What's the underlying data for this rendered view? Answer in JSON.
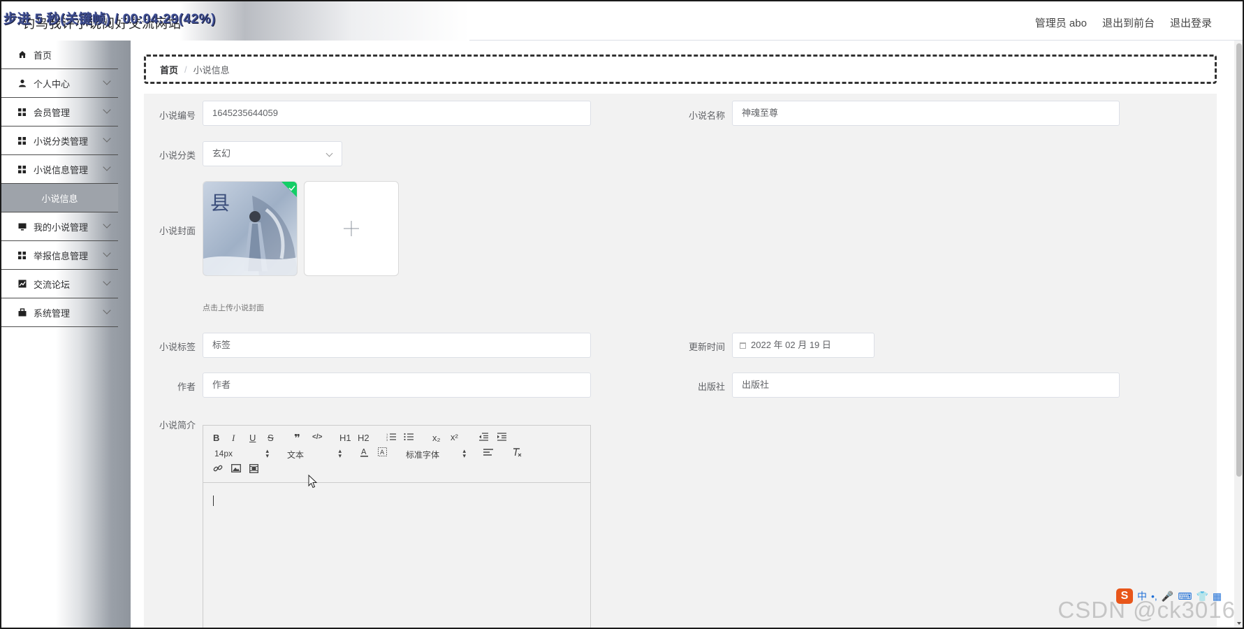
{
  "header": {
    "site_title": "钓鸟我评小说阅好交流网站",
    "overlay_caption": "步进 5 秒(关键帧) / 00:04:29(42%)",
    "links": [
      "管理员 abo",
      "退出到前台",
      "退出登录"
    ]
  },
  "sidebar": {
    "items": [
      {
        "label": "首页",
        "icon": "home-icon"
      },
      {
        "label": "个人中心",
        "icon": "user-icon"
      },
      {
        "label": "会员管理",
        "icon": "grid-icon"
      },
      {
        "label": "小说分类管理",
        "icon": "grid-icon"
      },
      {
        "label": "小说信息管理",
        "icon": "grid-icon"
      },
      {
        "label": "我的小说管理",
        "icon": "monitor-icon"
      },
      {
        "label": "举报信息管理",
        "icon": "grid-icon"
      },
      {
        "label": "交流论坛",
        "icon": "chart-icon"
      },
      {
        "label": "系统管理",
        "icon": "briefcase-icon"
      }
    ],
    "active_sub": "小说信息"
  },
  "breadcrumb": {
    "home": "首页",
    "separator": "/",
    "current": "小说信息"
  },
  "form": {
    "novel_no": {
      "label": "小说编号",
      "value": "1645235644059"
    },
    "novel_name": {
      "label": "小说名称",
      "value": "神魂至尊"
    },
    "category": {
      "label": "小说分类",
      "value": "玄幻"
    },
    "cover": {
      "label": "小说封面",
      "tip": "点击上传小说封面"
    },
    "tags": {
      "label": "小说标签",
      "placeholder": "标签"
    },
    "update_time": {
      "label": "更新时间",
      "value": "2022 年 02 月 19 日"
    },
    "author": {
      "label": "作者",
      "placeholder": "作者"
    },
    "publisher": {
      "label": "出版社",
      "placeholder": "出版社"
    },
    "intro": {
      "label": "小说简介"
    }
  },
  "editor": {
    "row1": [
      "B",
      "I",
      "U",
      "S",
      "❞",
      "</>",
      "H1",
      "H2",
      "ol",
      "ul",
      "x₂",
      "x²",
      "outdent",
      "indent"
    ],
    "font_size": "14px",
    "text_style": "文本",
    "font_family": "标准字体"
  },
  "watermark": "CSDN @ck3016",
  "ime": {
    "logo": "S",
    "text": "中"
  },
  "colors": {
    "upload_check": "#13ce66",
    "menu_active_bg": "#9ea3aa"
  }
}
